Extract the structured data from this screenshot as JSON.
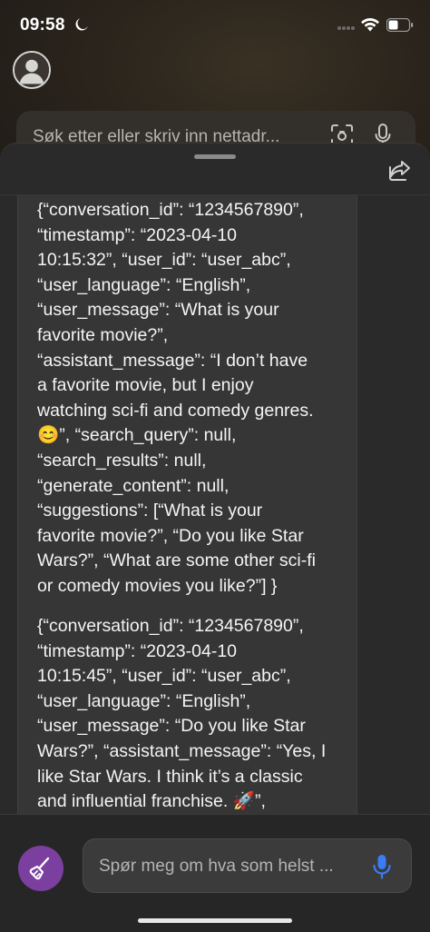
{
  "status_bar": {
    "time": "09:58",
    "icons": [
      "moon-icon",
      "wifi-icon",
      "battery-icon"
    ]
  },
  "browser": {
    "search_placeholder": "Søk etter eller skriv inn nettadr...",
    "icons": [
      "avatar",
      "scan-icon",
      "microphone-icon"
    ]
  },
  "sheet": {
    "icons": [
      "share-icon"
    ],
    "messages": [
      "{“conversation_id”: “1234567890”,\n“timestamp”: “2023-04-10\n10:15:32”, “user_id”: “user_abc”,\n“user_language”: “English”,\n“user_message”: “What is your\nfavorite movie?”,\n“assistant_message”: “I don’t have\na favorite movie, but I enjoy\nwatching sci-fi and comedy genres.\n😊”, “search_query”: null,\n“search_results”: null,\n“generate_content”: null,\n“suggestions”: [“What is your\nfavorite movie?”, “Do you like Star\nWars?”, “What are some other sci-fi\nor comedy movies you like?”] }",
      "{“conversation_id”: “1234567890”,\n“timestamp”: “2023-04-10\n10:15:45”, “user_id”: “user_abc”,\n“user_language”: “English”,\n“user_message”: “Do you like Star\nWars?”, “assistant_message”: “Yes, I\nlike Star Wars. I think it’s a classic\nand influential franchise. 🚀”,"
    ]
  },
  "composer": {
    "placeholder": "Spør meg om hva som helst ...",
    "icons": [
      "broom-icon",
      "microphone-icon"
    ],
    "accent_color": "#7b3fa0",
    "mic_color": "#3b7cf6"
  }
}
